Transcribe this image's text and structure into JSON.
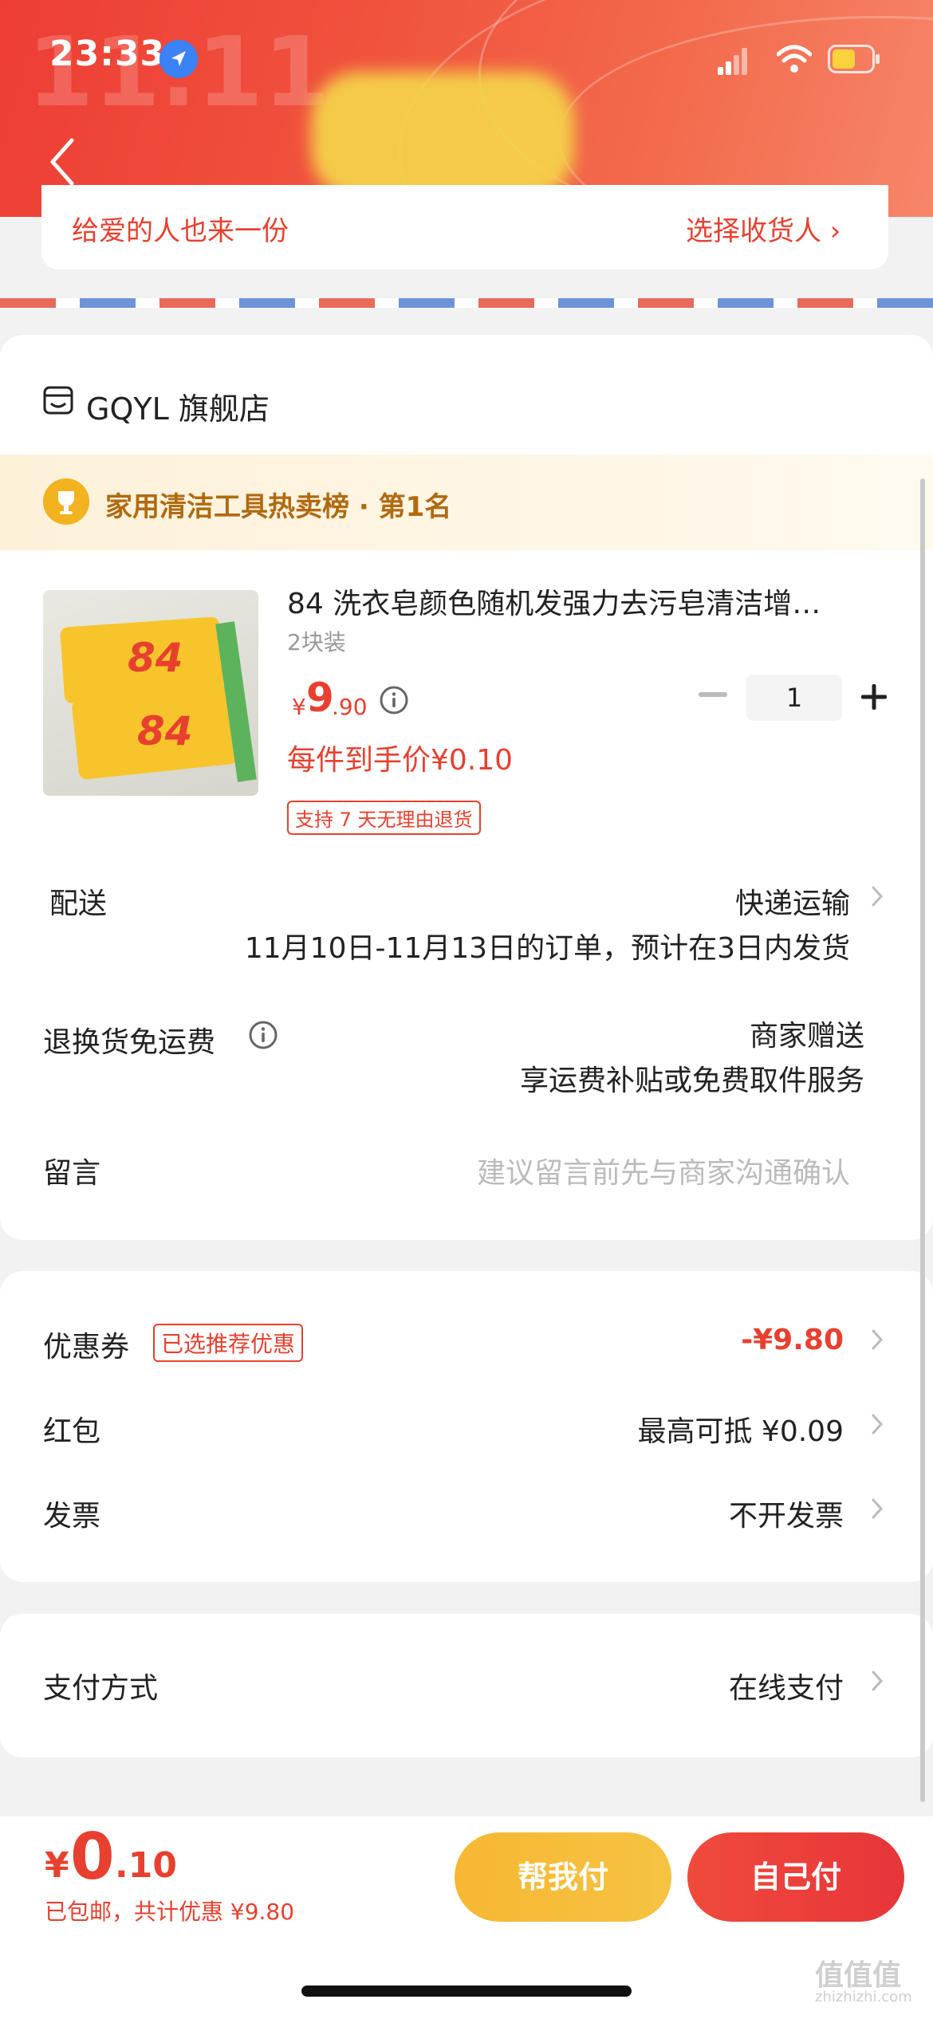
{
  "status_bar": {
    "time": "23:33"
  },
  "header": {
    "logo": "11.11"
  },
  "gift": {
    "text": "给爱的人也来一份",
    "link": "选择收货人 ›"
  },
  "store": {
    "name": "GQYL 旗舰店"
  },
  "ranking": {
    "text": "家用清洁工具热卖榜 · 第1名"
  },
  "product": {
    "title": "84 洗衣皂颜色随机发强力去污皂清洁增…",
    "spec": "2块装",
    "price_symbol": "¥",
    "price_int": "9",
    "price_dec": ".90",
    "quantity": "1",
    "unit_price": "每件到手价¥0.10",
    "return_policy": "支持 7 天无理由退货",
    "image_text": "84"
  },
  "delivery": {
    "label": "配送",
    "method": "快递运输",
    "note": "11月10日-11月13日的订单，预计在3日内发货"
  },
  "return_shipping": {
    "label": "退换货免运费",
    "value": "商家赠送",
    "desc": "享运费补贴或免费取件服务"
  },
  "message": {
    "label": "留言",
    "placeholder": "建议留言前先与商家沟通确认"
  },
  "coupon": {
    "label": "优惠券",
    "tag": "已选推荐优惠",
    "value": "-¥9.80"
  },
  "red_packet": {
    "label": "红包",
    "value": "最高可抵 ¥0.09"
  },
  "invoice": {
    "label": "发票",
    "value": "不开发票"
  },
  "payment": {
    "label": "支付方式",
    "value": "在线支付"
  },
  "total": {
    "symbol": "¥",
    "int": "0",
    "dec": ".10",
    "sub": "已包邮，共计优惠 ¥9.80"
  },
  "buttons": {
    "help_pay": "帮我付",
    "self_pay": "自己付"
  },
  "watermark": {
    "main": "值值值",
    "sub": "zhizhizhi.com"
  },
  "colors": {
    "accent": "#e8402f",
    "header": "#ee3d35",
    "help_button": "#f7b733"
  }
}
